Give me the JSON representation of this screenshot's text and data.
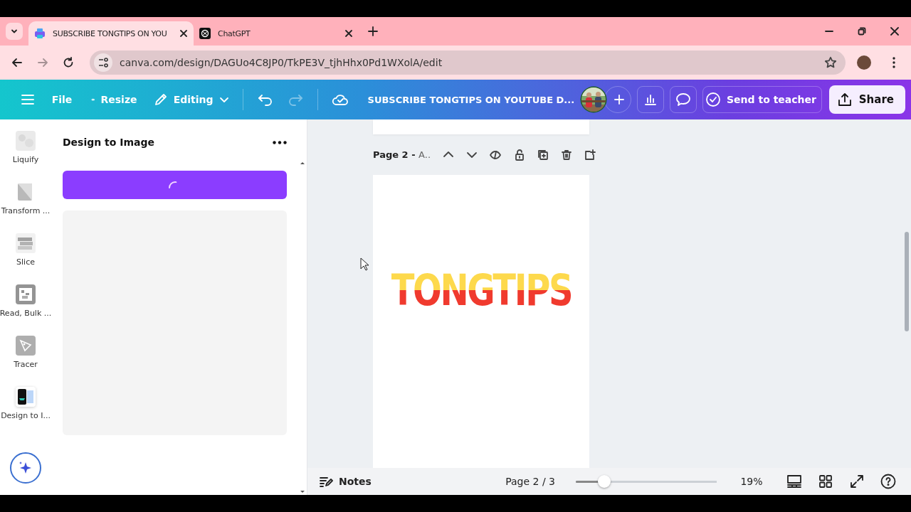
{
  "browser": {
    "tabs": [
      {
        "title": "SUBSCRIBE TONGTIPS ON YOU",
        "kind": "canva",
        "selected": true
      },
      {
        "title": "ChatGPT",
        "kind": "chatgpt",
        "selected": false
      }
    ],
    "address": "canva.com/design/DAGUo4C8JP0/TkPE3V_tjhHhx0Pd1WXolA/edit"
  },
  "toolbar": {
    "menu": [
      "File",
      "Resize",
      "Editing"
    ],
    "design_title": "SUBSCRIBE TONGTIPS ON YOUTUBE D...",
    "send": "Send to teacher",
    "share": "Share"
  },
  "apps": [
    {
      "label": "Liquify",
      "kind": "liquify",
      "selected": false
    },
    {
      "label": "Transform ...",
      "kind": "transform",
      "selected": false
    },
    {
      "label": "Slice",
      "kind": "slice",
      "selected": false
    },
    {
      "label": "Read, Bulk ...",
      "kind": "qr",
      "selected": false
    },
    {
      "label": "Tracer",
      "kind": "pen",
      "selected": false
    },
    {
      "label": "Design to I...",
      "kind": "design",
      "selected": true
    }
  ],
  "panel": {
    "title": "Design to Image",
    "button_loading": true
  },
  "canvas": {
    "page_label": "Page 2 - ",
    "page_title": "A..",
    "design_text": "TONGTIPS"
  },
  "footer": {
    "notes": "Notes",
    "page": "Page 2 / 3",
    "zoom": {
      "level": 0.2
    },
    "zoom_reading": "19%"
  }
}
